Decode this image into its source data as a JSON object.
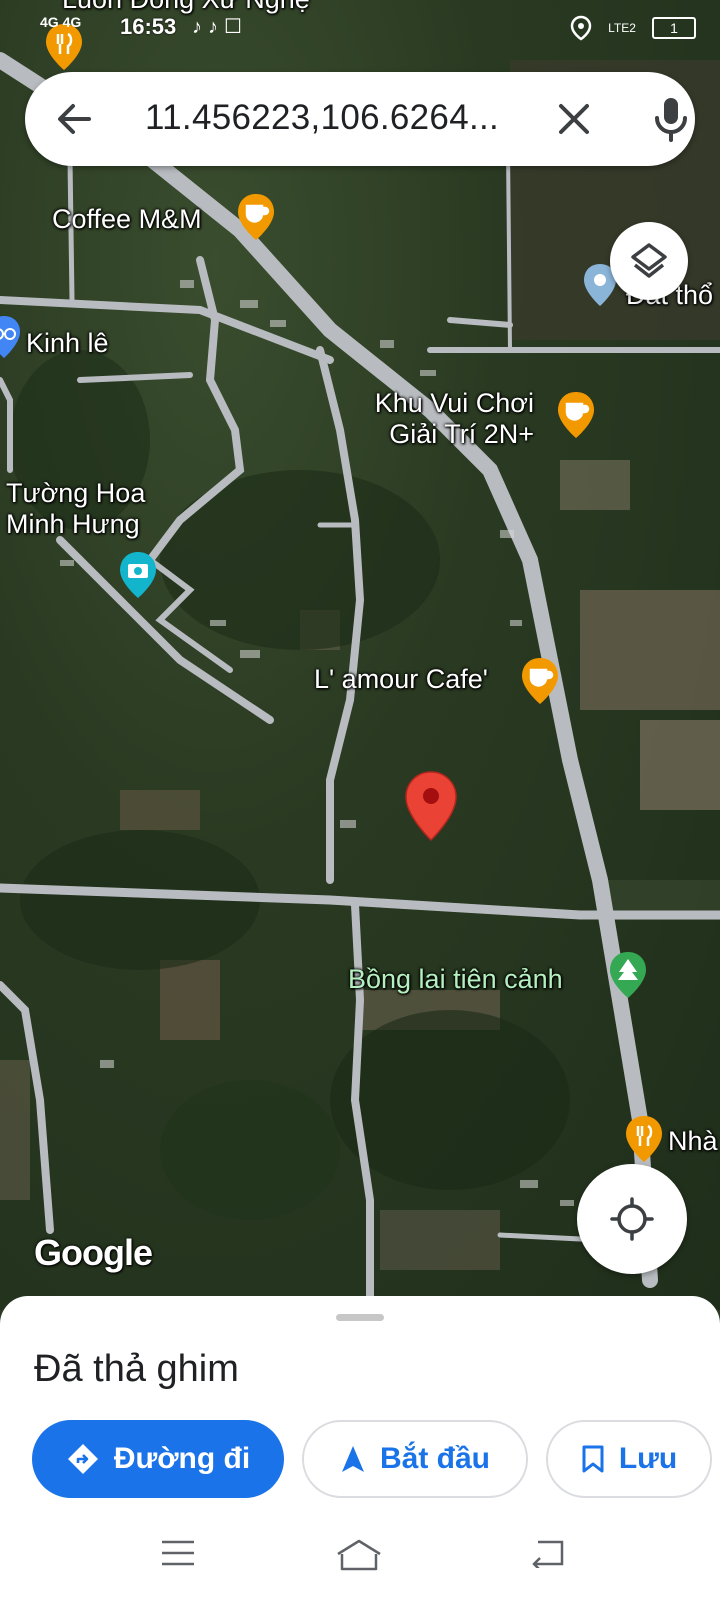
{
  "status_bar": {
    "time": "16:53",
    "network_left": "4G",
    "network_right": "4G",
    "carrier": "LTE2",
    "battery": "1",
    "app_icons": [
      "tiktok-icon",
      "tiktok-icon",
      "zalo-icon"
    ]
  },
  "search": {
    "query": "11.456223,106.6264..."
  },
  "map": {
    "top_partial_label": "Luôn Đông Xứ Nghệ",
    "pois": [
      {
        "name": "Coffee M&M",
        "type": "cafe"
      },
      {
        "name": "Đất thổ",
        "type": "place"
      },
      {
        "name": "Kinh lê",
        "type": "bike"
      },
      {
        "name": "Khu Vui Chơi",
        "name2": "Giải Trí 2N+",
        "type": "cafe"
      },
      {
        "name": "Tường Hoa",
        "name2": "Minh Hưng",
        "type": "photo"
      },
      {
        "name": "L' amour Cafe'",
        "type": "cafe"
      },
      {
        "name": "Bồng lai tiên cảnh",
        "type": "park"
      },
      {
        "name": "Nhà",
        "type": "restaurant"
      }
    ],
    "attribution": "Google"
  },
  "sheet": {
    "title": "Đã thả ghim",
    "directions_label": "Đường đi",
    "start_label": "Bắt đầu",
    "save_label": "Lưu"
  },
  "colors": {
    "primary": "#1a73e8",
    "pin_red": "#ea4335",
    "cafe_orange": "#f29900",
    "photo_teal": "#12b5cb",
    "park_green": "#34a853"
  }
}
